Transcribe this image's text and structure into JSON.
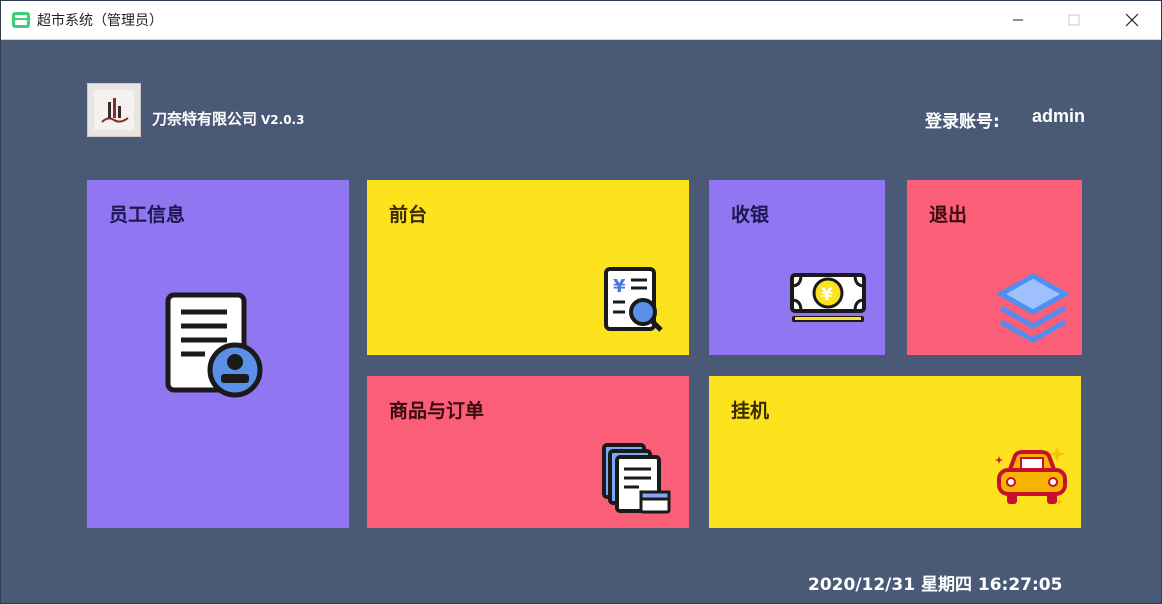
{
  "window": {
    "title": "超市系统（管理员）",
    "controls": [
      "minimize-icon",
      "maximize-icon",
      "close-icon"
    ]
  },
  "header": {
    "company_name": "刀奈特有限公司",
    "version": "V2.0.3",
    "login_label": "登录账号:",
    "login_user": "admin"
  },
  "tiles": {
    "staff": {
      "label": "员工信息",
      "icon": "employee-document-icon"
    },
    "front": {
      "label": "前台",
      "icon": "receipt-search-icon"
    },
    "cashier": {
      "label": "收银",
      "icon": "banknote-yen-icon"
    },
    "exit": {
      "label": "退出",
      "icon": "layers-icon"
    },
    "goods": {
      "label": "商品与订单",
      "icon": "documents-order-icon"
    },
    "idle": {
      "label": "挂机",
      "icon": "car-icon"
    }
  },
  "footer": {
    "datetime": "2020/12/31 星期四 16:27:05"
  },
  "colors": {
    "background": "#4a5a76",
    "purple": "#9176f2",
    "yellow": "#fde21e",
    "pink": "#fb5f77"
  }
}
